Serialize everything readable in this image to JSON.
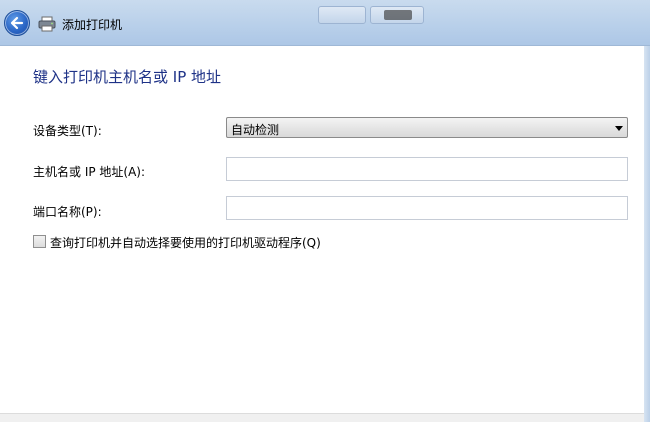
{
  "window": {
    "title": "添加打印机",
    "icons": {
      "back": "back-arrow-icon",
      "app": "printer-icon"
    }
  },
  "form": {
    "heading": "键入打印机主机名或 IP 地址",
    "device_type": {
      "label": "设备类型(T):",
      "value": "自动检测"
    },
    "hostname": {
      "label": "主机名或 IP 地址(A):",
      "value": ""
    },
    "port_name": {
      "label": "端口名称(P):",
      "value": ""
    },
    "auto_detect_driver": {
      "label": "查询打印机并自动选择要使用的打印机驱动程序(Q)",
      "checked": false
    }
  },
  "colors": {
    "heading": "#1e3287",
    "titlebar": "#b9d0ea",
    "back_button": "#2a66c6"
  }
}
